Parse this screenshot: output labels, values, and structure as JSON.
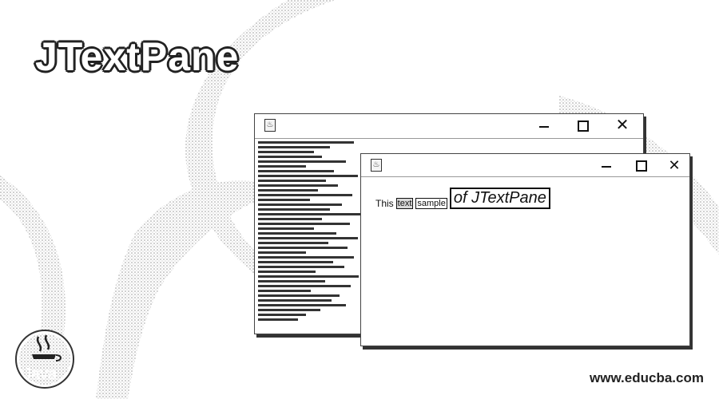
{
  "header": {
    "title": "JTextPane"
  },
  "windows": {
    "back": {
      "app_icon": "java-app-icon",
      "controls": [
        "minimize-icon",
        "maximize-icon",
        "close-icon"
      ]
    },
    "front": {
      "app_icon": "java-app-icon",
      "controls": [
        "minimize-icon",
        "maximize-icon",
        "close-icon"
      ],
      "content": {
        "w1": "This",
        "w2": "text",
        "w3": "sample",
        "w4": "of JTextPane"
      }
    }
  },
  "branding": {
    "logo_label": "Java",
    "url": "www.educba.com"
  },
  "colors": {
    "background": "#ffffff",
    "ink": "#111111"
  }
}
